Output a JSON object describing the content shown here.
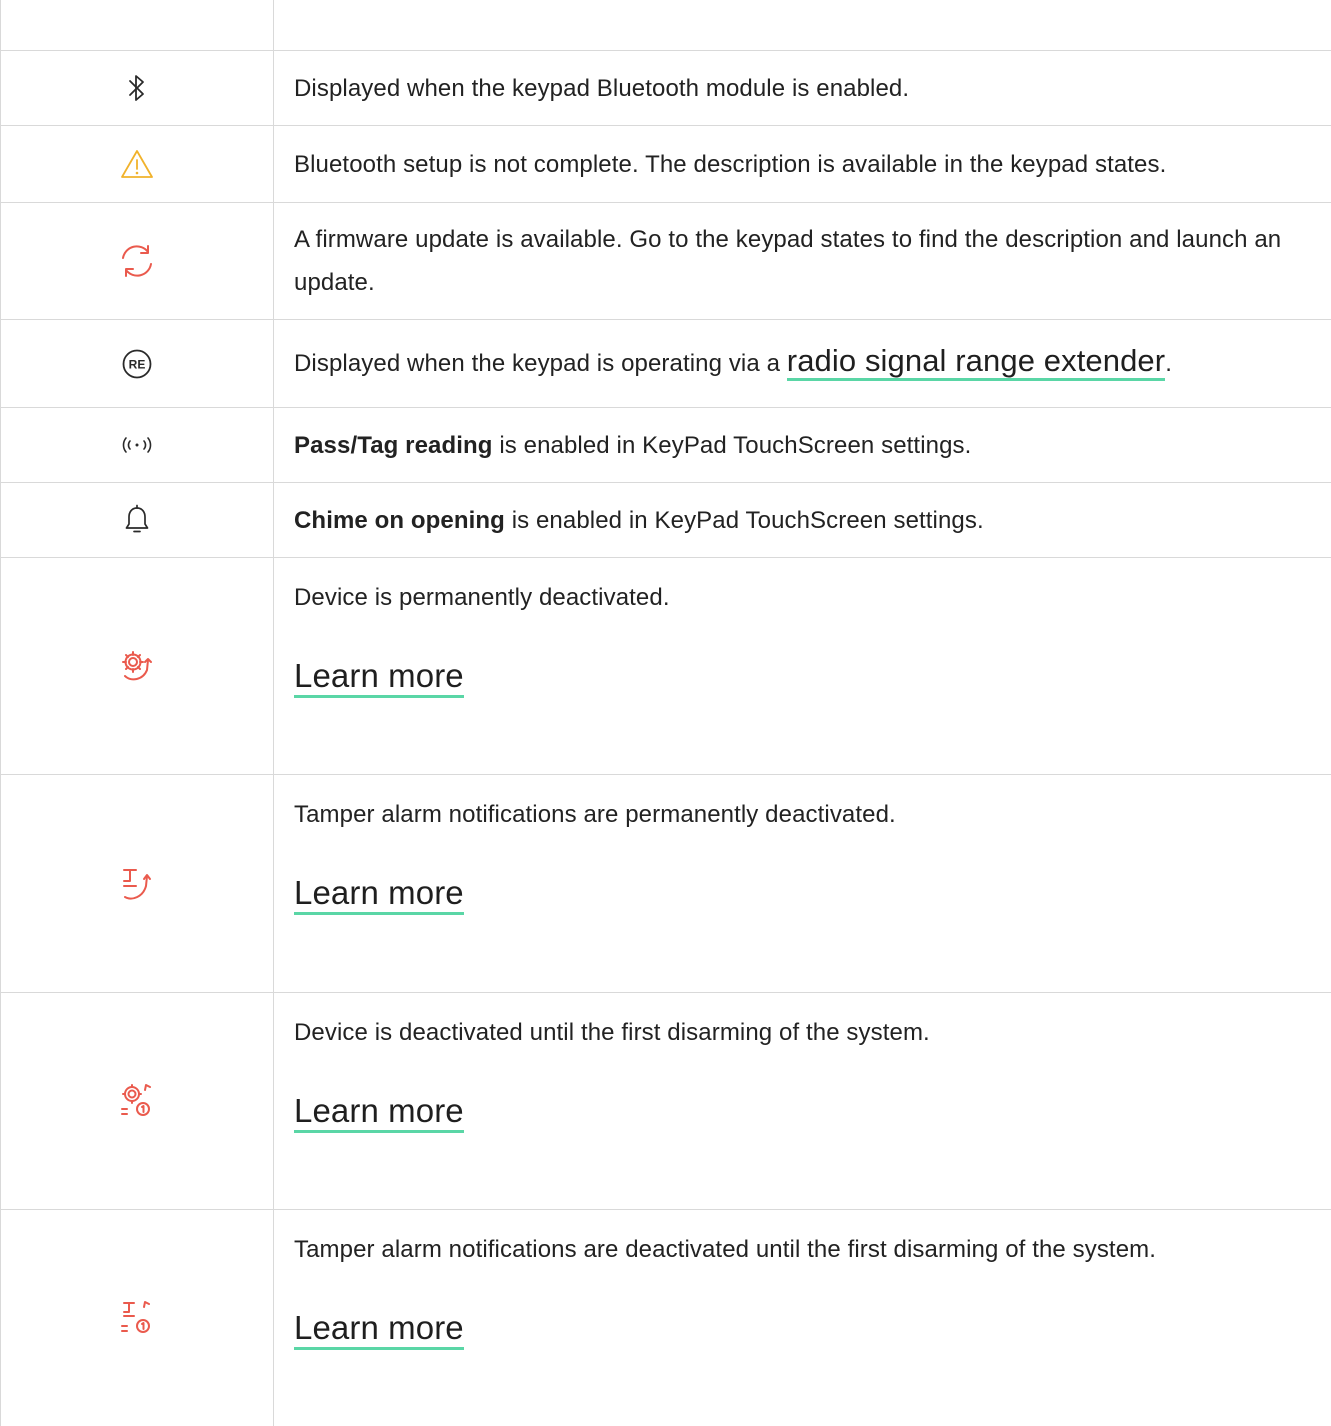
{
  "colors": {
    "icon_dark": "#2a2a2a",
    "icon_warning": "#f1b22b",
    "icon_red": "#ea5a4d",
    "link_underline": "#5ad6a6",
    "border": "#d9d9d9"
  },
  "rows": [
    {
      "icon": "bluetooth-icon",
      "text": "Displayed when the keypad Bluetooth module is enabled."
    },
    {
      "icon": "warning-icon",
      "text": "Bluetooth setup is not complete. The description is available in the keypad states."
    },
    {
      "icon": "update-icon",
      "text": "A firmware update is available. Go to the keypad states to find the description and launch an update."
    },
    {
      "icon": "range-extender-icon",
      "text_before": "Displayed when the keypad is operating via a ",
      "link": "radio signal range extender",
      "text_after": "."
    },
    {
      "icon": "pass-tag-reading-icon",
      "bold": "Pass/Tag reading",
      "text": " is enabled in KeyPad TouchScreen settings."
    },
    {
      "icon": "chime-bell-icon",
      "bold": "Chime on opening",
      "text": " is enabled in KeyPad TouchScreen settings."
    },
    {
      "icon": "device-deactivated-permanent-icon",
      "text": "Device is permanently deactivated.",
      "link": "Learn more"
    },
    {
      "icon": "tamper-deactivated-permanent-icon",
      "text": "Tamper alarm notifications are permanently deactivated.",
      "link": "Learn more"
    },
    {
      "icon": "device-deactivated-once-icon",
      "text": "Device is deactivated until the first disarming of the system.",
      "link": "Learn more"
    },
    {
      "icon": "tamper-deactivated-once-icon",
      "text": "Tamper alarm notifications are deactivated until the first disarming of the system.",
      "link": "Learn more"
    }
  ]
}
